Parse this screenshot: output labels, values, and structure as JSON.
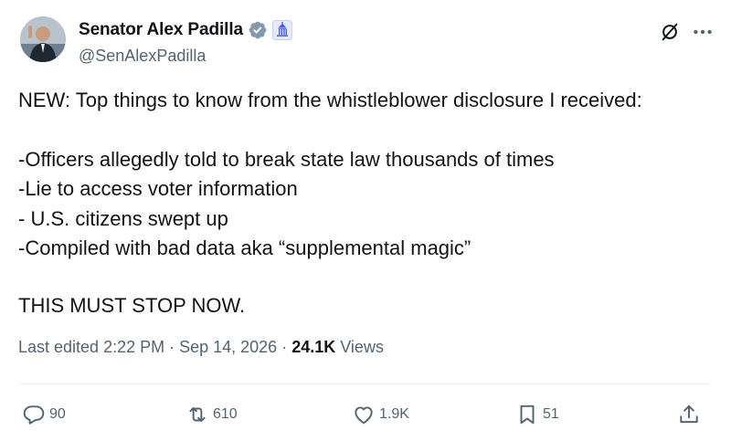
{
  "author": {
    "name": "Senator Alex Padilla",
    "handle": "@SenAlexPadilla"
  },
  "post": {
    "lines": [
      "NEW: Top things to know from the whistleblower disclosure I received:",
      "-Officers allegedly told to break state law thousands of times",
      "-Lie to access voter information",
      "- U.S. citizens swept up",
      "-Compiled with bad data aka “supplemental magic”",
      "THIS MUST STOP NOW."
    ]
  },
  "meta": {
    "edited_prefix": "Last edited 2:22 PM · Sep 14, 2026 · ",
    "views_count": "24.1K",
    "views_label": " Views"
  },
  "actions": {
    "replies": "90",
    "reposts": "610",
    "likes": "1.9K",
    "bookmarks": "51"
  },
  "colors": {
    "verified": "#829aab",
    "secondary_text": "#536471",
    "primary_text": "#0f1419"
  },
  "icons": [
    "verified-badge-icon",
    "government-building-icon",
    "grok-icon",
    "more-icon",
    "reply-icon",
    "repost-icon",
    "like-icon",
    "bookmark-icon",
    "share-icon"
  ]
}
